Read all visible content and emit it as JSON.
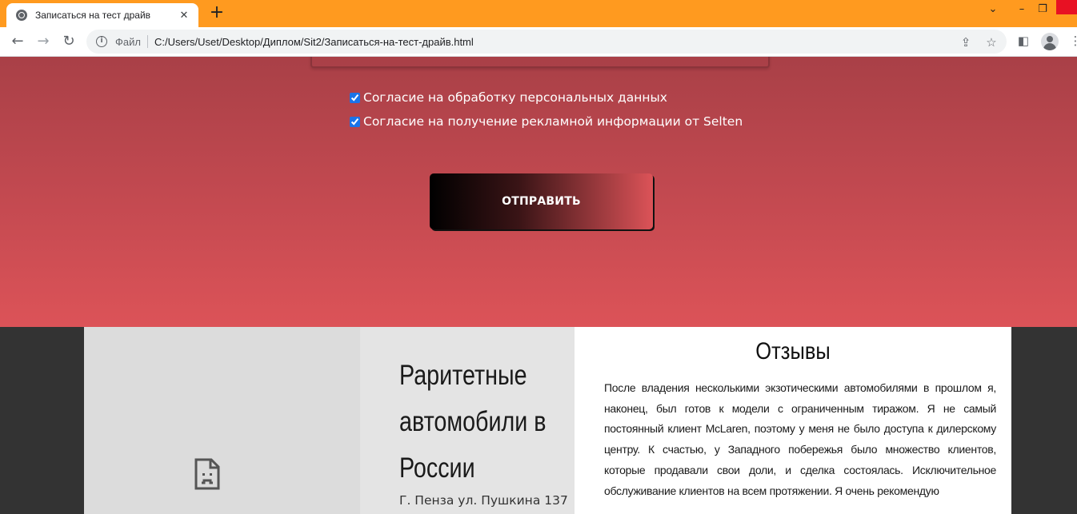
{
  "browser": {
    "tab_title": "Записаться на тест драйв",
    "tab_close": "✕",
    "new_tab": "+",
    "file_label": "Файл",
    "url": "C:/Users/Uset/Desktop/Диплом/Sit2/Записаться-на-тест-драйв.html",
    "window_controls": [
      "⌄",
      "–",
      "❐"
    ]
  },
  "form": {
    "consents": [
      {
        "label": "Согласие на обработку персональных данных",
        "checked": true
      },
      {
        "label": "Согласие на получение рекламной информации от Selten",
        "checked": true
      }
    ],
    "submit_label": "ОТПРАВИТЬ"
  },
  "footer": {
    "company_name": "Раритетные автомобили в России",
    "address": "Г. Пенза ул. Пушкина 137",
    "reviews_title": "Отзывы",
    "review_text": "После владения несколькими экзотическими автомобилями в прошлом я, наконец, был готов к модели с ограниченным тиражом. Я не самый постоянный клиент McLaren, поэтому у меня не было доступа к дилерскому центру. К счастью, у Западного побережья было множество клиентов, которые продавали свои доли, и сделка состоялась. Исключительное обслуживание клиентов на всем протяжении. Я очень рекомендую"
  },
  "colors": {
    "tabbar": "#ff9a1f",
    "form_gradient_top": "#a94047",
    "form_gradient_bottom": "#dc5358",
    "footer_bg": "#333333"
  }
}
